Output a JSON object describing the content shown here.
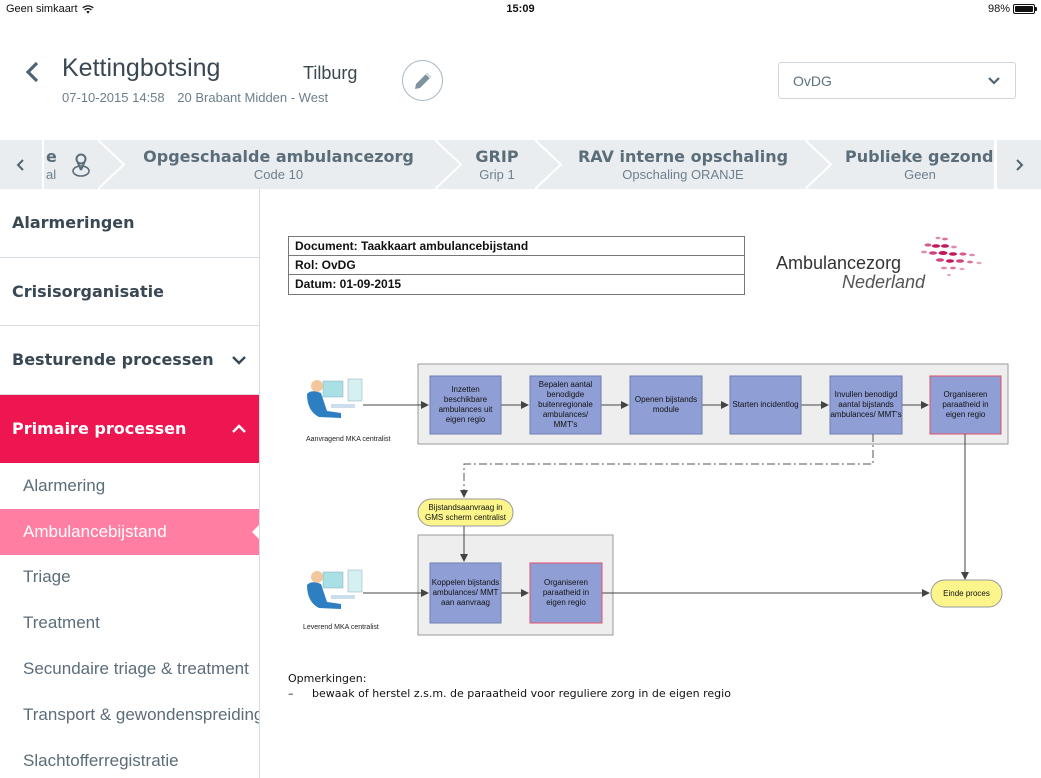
{
  "status_bar": {
    "carrier": "Geen simkaart",
    "time": "15:09",
    "battery": "98%",
    "battery_level": 0.98
  },
  "header": {
    "title": "Kettingbotsing",
    "city": "Tilburg",
    "datetime": "07-10-2015 14:58",
    "region": "20 Brabant Midden - West",
    "role_select": {
      "value": "OvDG"
    }
  },
  "breadcrumbs": [
    {
      "title": "e",
      "subtitle": "al",
      "partial": true
    },
    {
      "title": "Opgeschaalde ambulancezorg",
      "subtitle": "Code 10"
    },
    {
      "title": "GRIP",
      "subtitle": "Grip 1"
    },
    {
      "title": "RAV interne opschaling",
      "subtitle": "Opschaling ORANJE"
    },
    {
      "title": "Publieke gezond",
      "subtitle": "Geen",
      "partial": true
    }
  ],
  "sidebar": {
    "sections": [
      {
        "label": "Alarmeringen"
      },
      {
        "label": "Crisisorganisatie"
      },
      {
        "label": "Besturende processen",
        "expandable": true,
        "expanded": false
      },
      {
        "label": "Primaire processen",
        "expandable": true,
        "expanded": true,
        "active": true
      }
    ],
    "sub_items": [
      {
        "label": "Alarmering"
      },
      {
        "label": "Ambulancebijstand",
        "active": true
      },
      {
        "label": "Triage"
      },
      {
        "label": "Treatment"
      },
      {
        "label": "Secundaire triage & treatment"
      },
      {
        "label": "Transport & gewondenspreiding"
      },
      {
        "label": "Slachtofferregistratie"
      }
    ]
  },
  "document": {
    "meta": {
      "document": "Document: Taakkaart ambulancebijstand",
      "role": "Rol: OvDG",
      "date": "Datum: 01-09-2015"
    },
    "logo": {
      "line1": "Ambulancezorg",
      "line2": "Nederland"
    },
    "diagram": {
      "actors": {
        "requesting": "Aanvragend MKA centralist",
        "supplying": "Leverend MKA centralist"
      },
      "top_steps": [
        "Inzetten beschikbare ambulances uit eigen regio",
        "Bepalen aantal benodigde buitenregionale ambulances/ MMT's",
        "Openen bijstands module",
        "Starten incidentlog",
        "Invullen benodigd aantal bijstands ambulances/ MMT's",
        "Organiseren paraatheid in eigen regio"
      ],
      "request_note": "Bijstandsaanvraag in GMS scherm centralist",
      "bottom_steps": [
        "Koppelen bijstands ambulances/ MMT aan aanvraag",
        "Organiseren paraatheid in eigen regio"
      ],
      "end": "Einde proces",
      "colors": {
        "step_fill": "#8f9fd6",
        "step_border": "#6e7fb0",
        "highlight_border": "#e0506a",
        "terminal_fill": "#fbf58c",
        "lane_fill": "#eeeeee"
      }
    },
    "remarks": {
      "title": "Opmerkingen:",
      "items": [
        "bewaak of herstel z.s.m. de paraatheid voor reguliere zorg in de eigen regio"
      ]
    }
  },
  "colors": {
    "accent": "#ee1651",
    "accent_light": "#ff7ea1",
    "crumb_bg": "#e9edf0",
    "text_dark": "#3a4854"
  }
}
